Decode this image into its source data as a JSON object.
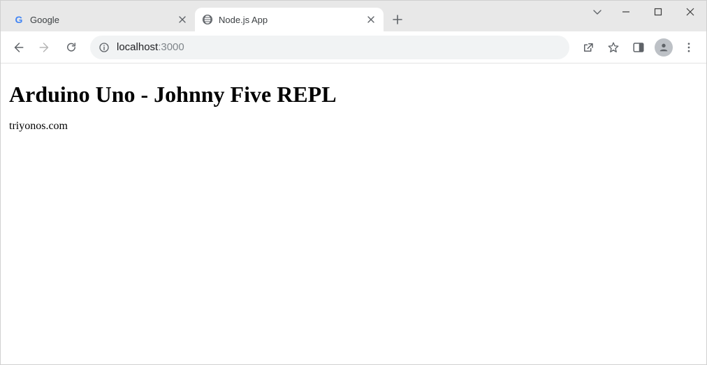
{
  "tabs": [
    {
      "title": "Google",
      "favicon": "google",
      "active": false
    },
    {
      "title": "Node.js App",
      "favicon": "globe",
      "active": true
    }
  ],
  "toolbar": {
    "url_host": "localhost",
    "url_port": ":3000"
  },
  "page": {
    "heading": "Arduino Uno - Johnny Five REPL",
    "body": "triyonos.com"
  }
}
